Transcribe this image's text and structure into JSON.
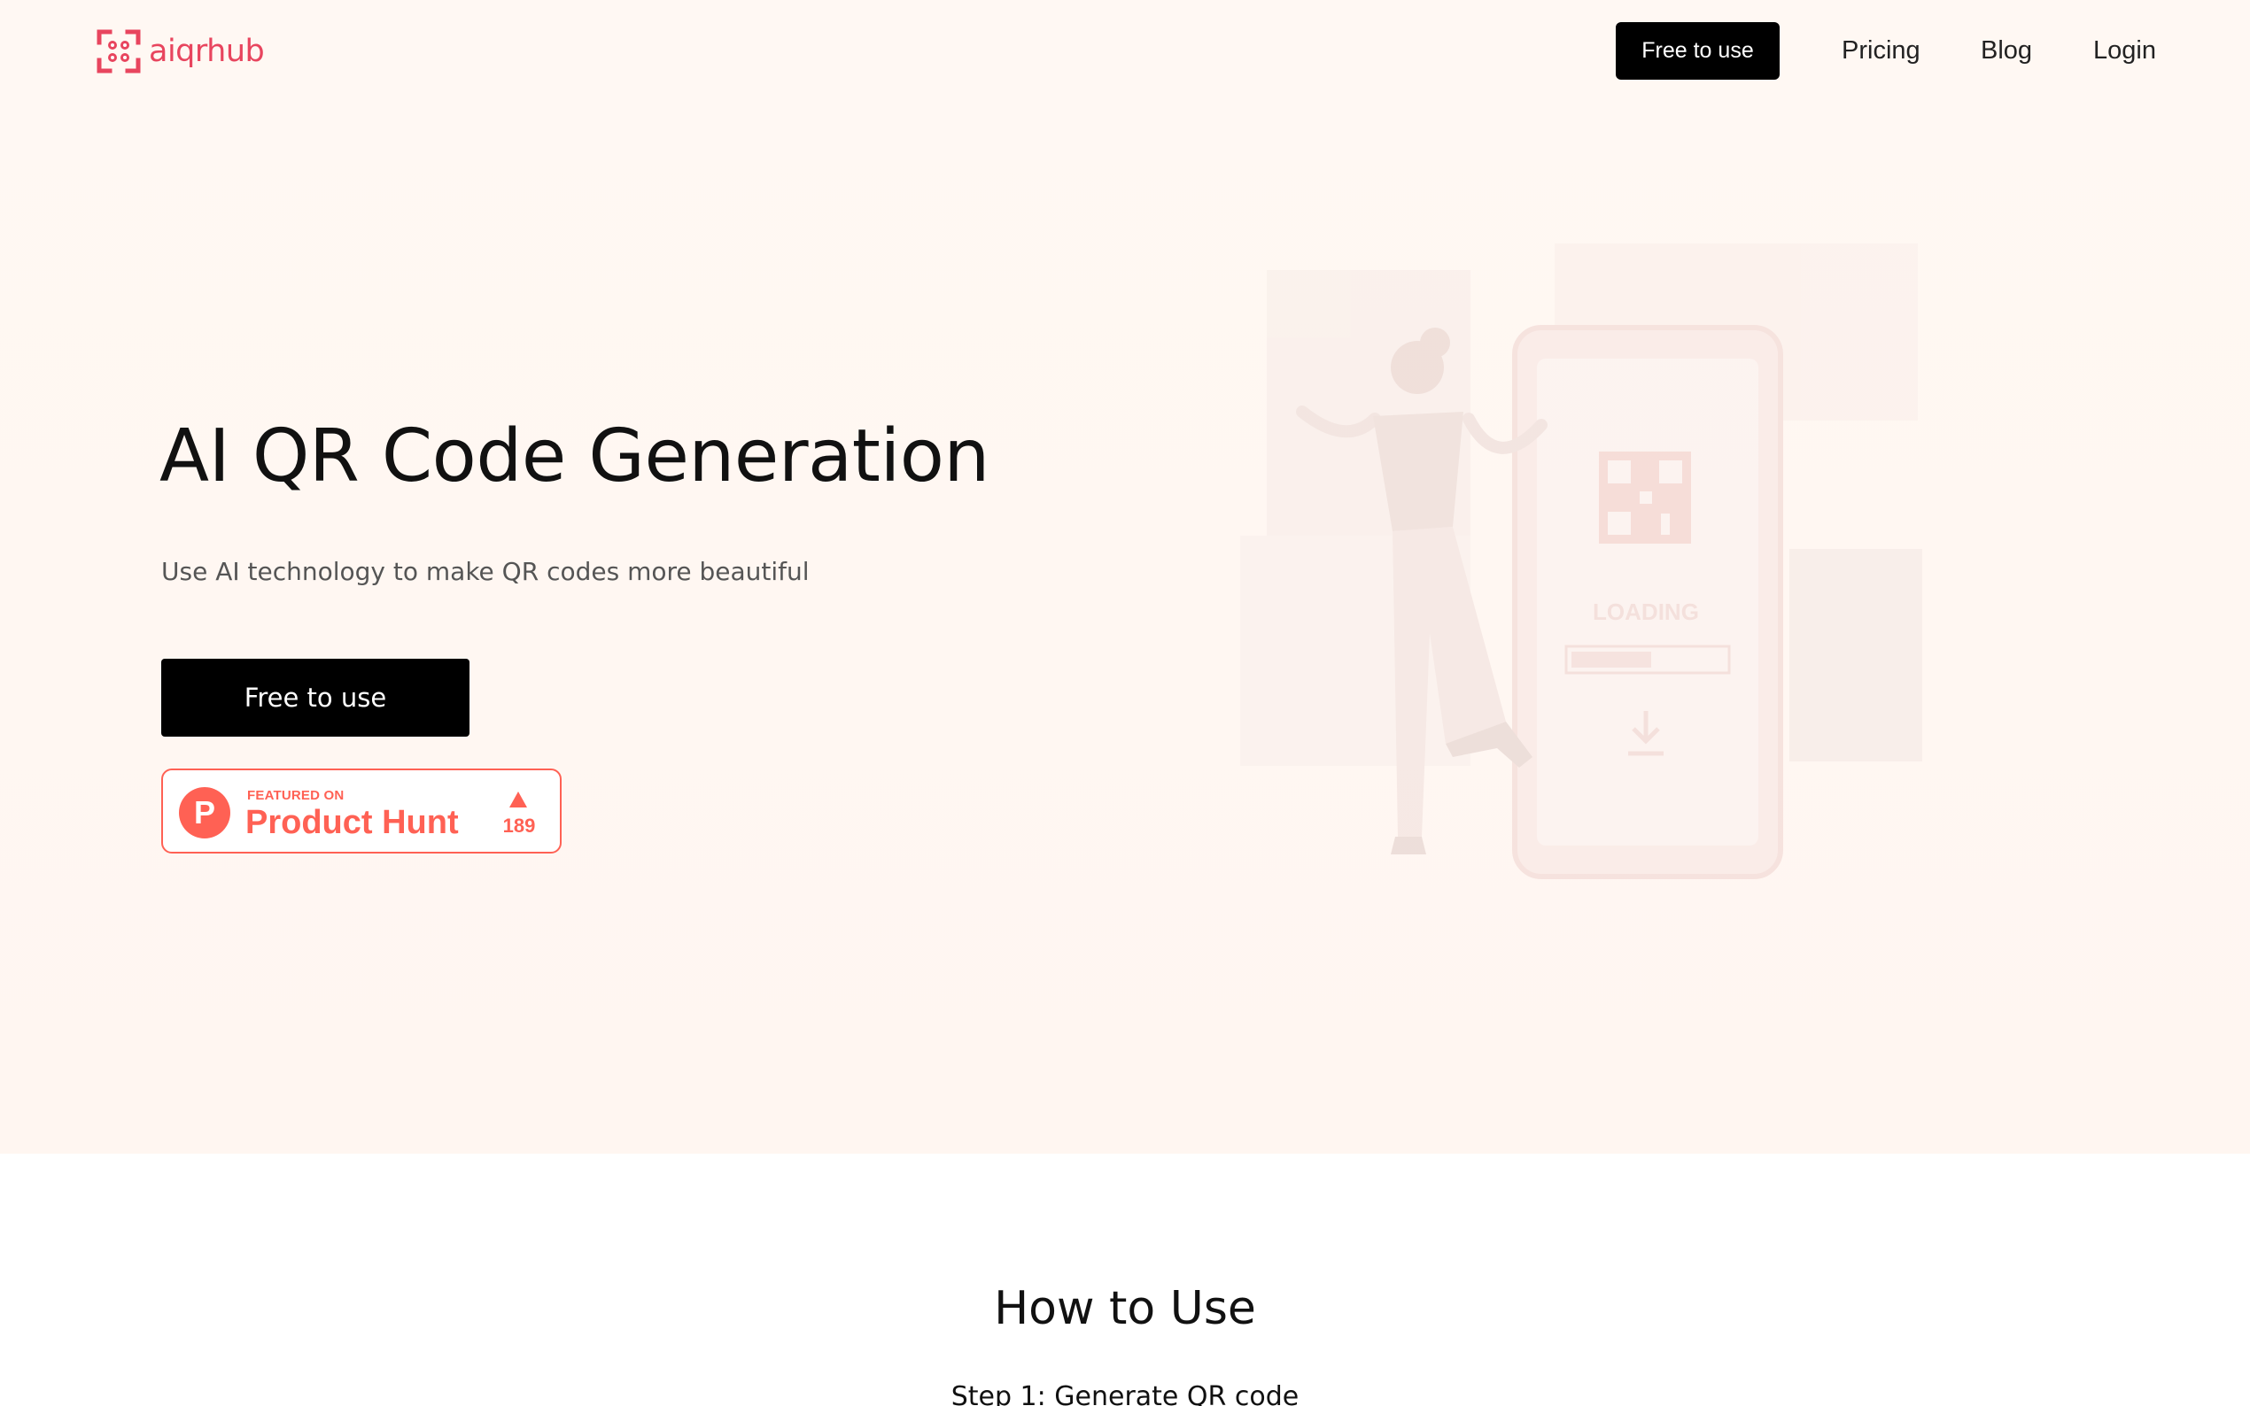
{
  "brand": {
    "name": "aiqrhub",
    "accent_color": "#e8455e"
  },
  "nav": {
    "cta_label": "Free to use",
    "links": [
      "Pricing",
      "Blog",
      "Login"
    ]
  },
  "hero": {
    "title": "AI QR Code Generation",
    "subtitle": "Use AI technology to make QR codes more beautiful",
    "cta_label": "Free to use",
    "illustration_icon": "woman-with-phone-loading-illustration",
    "illustration_loading_text": "LOADING"
  },
  "product_hunt": {
    "featured_label": "FEATURED ON",
    "name": "Product Hunt",
    "logo_letter": "P",
    "upvotes": "189",
    "color": "#ff6154"
  },
  "howto": {
    "title": "How to Use",
    "step1_title": "Step 1: Generate QR code"
  }
}
